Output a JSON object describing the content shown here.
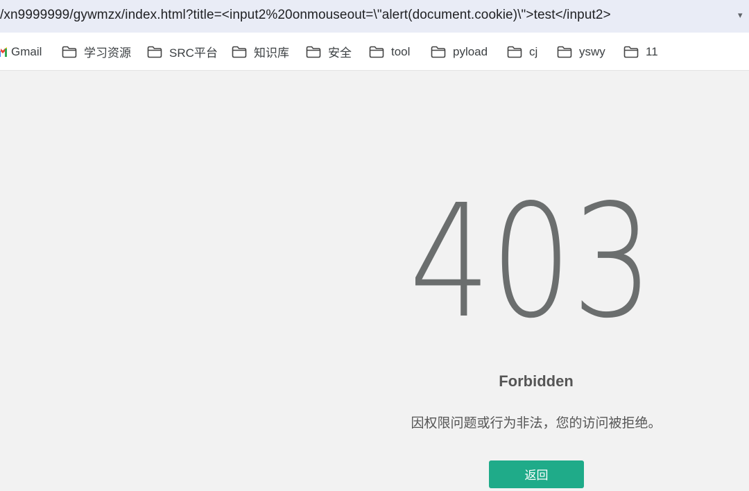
{
  "address_bar": {
    "url": "/xn9999999/gywmzx/index.html?title=<input2%20onmouseout=\\\"alert(document.cookie)\\\">test</input2>"
  },
  "bookmarks": [
    {
      "label": "Gmail",
      "icon": "gmail-icon"
    },
    {
      "label": "学习资源",
      "icon": "folder-icon"
    },
    {
      "label": "SRC平台",
      "icon": "folder-icon"
    },
    {
      "label": "知识库",
      "icon": "folder-icon"
    },
    {
      "label": "安全",
      "icon": "folder-icon"
    },
    {
      "label": "tool",
      "icon": "folder-icon"
    },
    {
      "label": "pyload",
      "icon": "folder-icon"
    },
    {
      "label": "cj",
      "icon": "folder-icon"
    },
    {
      "label": "yswy",
      "icon": "folder-icon"
    },
    {
      "label": "11",
      "icon": "folder-icon"
    }
  ],
  "error_page": {
    "code": "403",
    "title": "Forbidden",
    "message": "因权限问题或行为非法，您的访问被拒绝。",
    "back_button": "返回"
  },
  "colors": {
    "address_bar_bg": "#e9ecf6",
    "page_bg": "#f2f2f2",
    "code_color": "#6b6e6e",
    "button_bg": "#1fab89"
  }
}
